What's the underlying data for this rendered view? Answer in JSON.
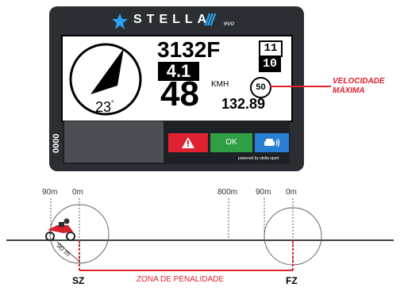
{
  "device": {
    "brand": "STELLA",
    "brand_suffix": "///",
    "brand_edition": "evo",
    "side_code": "0000",
    "sponsor": "powered by stella sport",
    "screen": {
      "code": "3132F",
      "distance": "4.1",
      "counter_top": "11",
      "counter_bottom": "10",
      "heading": "23",
      "heading_unit": "°",
      "speed": "48",
      "speed_unit": "KMH",
      "odometer": "132.89",
      "speed_limit": "50"
    },
    "buttons": {
      "warning_icon": "warning-triangle-icon",
      "ok_label": "OK",
      "car_icon": "car-signal-icon"
    }
  },
  "callout": {
    "line1": "VELOCIDADE",
    "line2": "MÁXIMA"
  },
  "diagram": {
    "labels": {
      "sz_90": "90m",
      "sz_0": "0m",
      "mid_800": "800m",
      "fz_90": "90m",
      "fz_0": "0m",
      "radius": "90 m"
    },
    "start_marker": "SZ",
    "end_marker": "FZ",
    "zone_label": "ZONA DE PENALIDADE"
  },
  "colors": {
    "accent_red": "#e02130",
    "ok_green": "#2f9e44",
    "info_blue": "#2a7fd4",
    "device_body": "#2b2f33"
  }
}
